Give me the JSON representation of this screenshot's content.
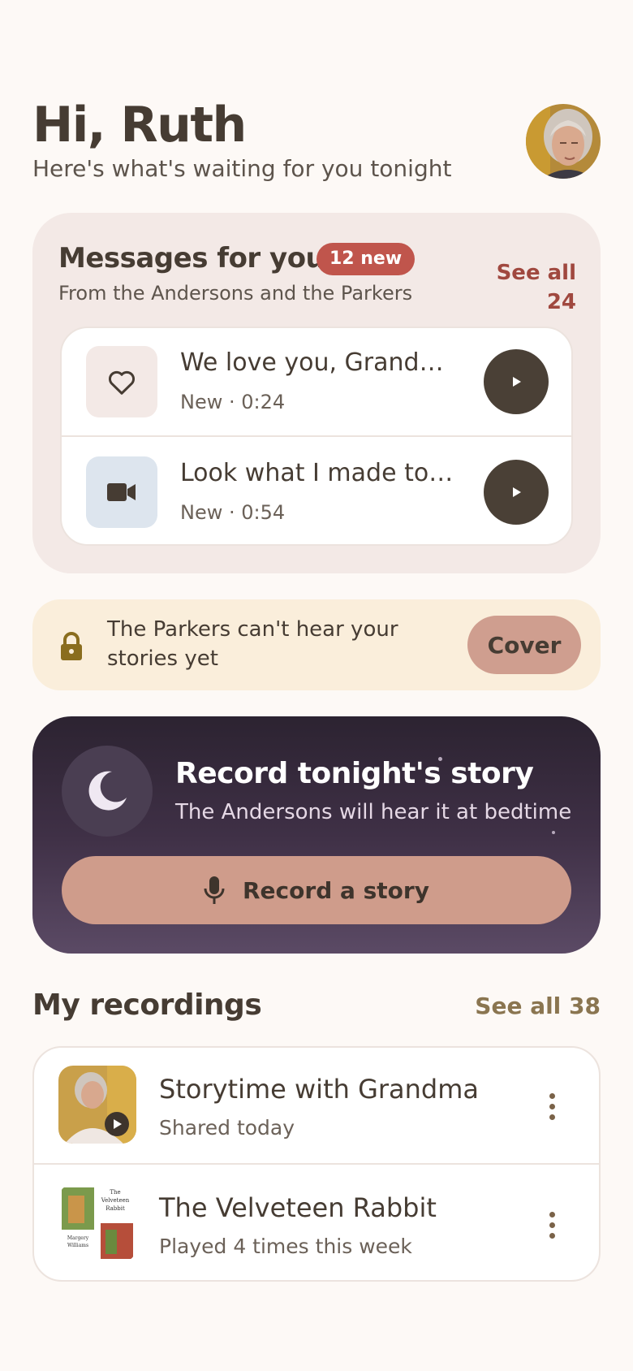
{
  "header": {
    "greeting": "Hi, Ruth",
    "subtitle": "Here's what's waiting for you tonight"
  },
  "messages": {
    "title": "Messages for you",
    "badge": "12 new",
    "subtitle": "From the Andersons and the Parkers",
    "see_all": "See all 24",
    "items": [
      {
        "title": "We love you, Grandma!",
        "meta": "New · 0:24",
        "icon": "heart-icon"
      },
      {
        "title": "Look what I made today!",
        "meta": "New · 0:54",
        "icon": "video-camera-icon"
      }
    ]
  },
  "privacy_banner": {
    "text": "The Parkers can't hear your stories yet",
    "button": "Cover",
    "icon": "lock-icon"
  },
  "record_card": {
    "title": "Record tonight's story",
    "subtitle": "The Andersons will hear it at bedtime",
    "button": "Record a story",
    "icons": [
      "moon-icon",
      "microphone-icon"
    ]
  },
  "recordings": {
    "title": "My recordings",
    "see_all": "See all 38",
    "items": [
      {
        "title": "Storytime with Grandma",
        "meta": "Shared today",
        "thumb_icon": "video-thumbnail-icon"
      },
      {
        "title": "The Velveteen Rabbit",
        "meta": "Played 4 times this week",
        "cover_text": {
          "title_line1": "The",
          "title_line2": "Velveteen",
          "title_line3": "Rabbit",
          "author_line1": "Margery",
          "author_line2": "Williams"
        }
      }
    ]
  },
  "colors": {
    "background": "#fdf9f6",
    "badge": "#c0554c",
    "accent": "#cf9c8b",
    "record_card_top": "#2c2331",
    "record_card_bottom": "#5b4a65",
    "banner": "#faeedb"
  }
}
